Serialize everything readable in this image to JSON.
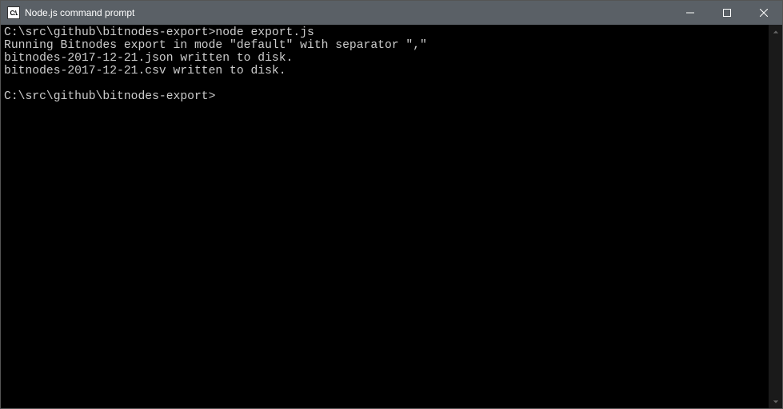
{
  "window": {
    "title": "Node.js command prompt",
    "icon_text": "C:\\."
  },
  "terminal": {
    "lines": [
      {
        "prompt": "C:\\src\\github\\bitnodes-export>",
        "command": "node export.js"
      },
      {
        "text": "Running Bitnodes export in mode \"default\" with separator \",\""
      },
      {
        "text": "bitnodes-2017-12-21.json written to disk."
      },
      {
        "text": "bitnodes-2017-12-21.csv written to disk."
      },
      {
        "text": ""
      },
      {
        "prompt": "C:\\src\\github\\bitnodes-export>",
        "command": ""
      }
    ]
  }
}
